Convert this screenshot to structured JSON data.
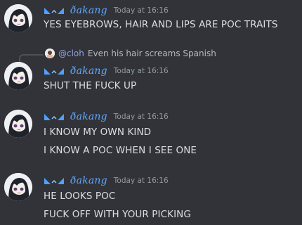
{
  "messages": [
    {
      "author": "ðakang",
      "timestamp": "Today at 16:16",
      "lines": [
        "YES EYEBROWS, HAIR AND LIPS ARE POC TRAITS"
      ]
    },
    {
      "reply": {
        "author": "@cloh",
        "text": "Even his hair screams Spanish"
      },
      "author": "ðakang",
      "timestamp": "Today at 16:16",
      "lines": [
        "SHUT THE FUCK UP"
      ]
    },
    {
      "author": "ðakang",
      "timestamp": "Today at 16:16",
      "lines": [
        "I KNOW MY OWN KIND",
        "I KNOW A POC WHEN I SEE ONE"
      ]
    },
    {
      "author": "ðakang",
      "timestamp": "Today at 16:16",
      "lines": [
        "HE LOOKS POC",
        "FUCK OFF WITH YOUR PICKING"
      ]
    }
  ],
  "colors": {
    "background": "#313338",
    "username": "#5fa8ff",
    "reply_username": "#8ea1e1",
    "text": "#dbdee1",
    "timestamp": "#949ba4"
  },
  "icons": {
    "role": "role-badge-icon",
    "avatar": "avatar-anime-girl"
  }
}
